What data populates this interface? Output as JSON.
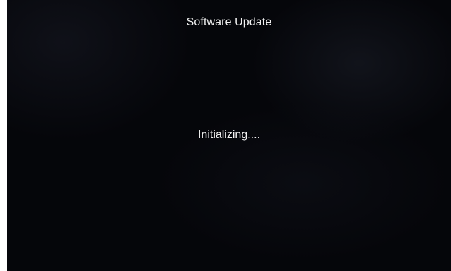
{
  "screen": {
    "title": "Software Update",
    "status_text": "Initializing....",
    "background_color": "#05060a",
    "text_color": "#f2f2f2"
  }
}
